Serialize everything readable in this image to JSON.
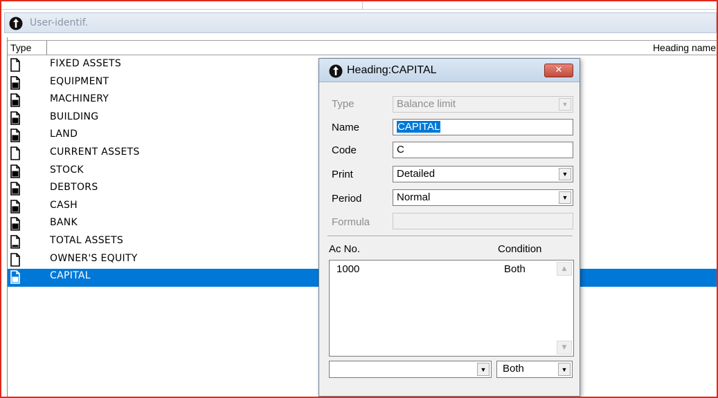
{
  "window": {
    "title": "User-identif."
  },
  "grid": {
    "columns": {
      "type": "Type",
      "heading_name": "Heading name"
    },
    "rows": [
      {
        "label": "FIXED ASSETS",
        "icon": "open-document-icon",
        "selected": false
      },
      {
        "label": "EQUIPMENT",
        "icon": "document-icon",
        "selected": false
      },
      {
        "label": "MACHINERY",
        "icon": "document-icon",
        "selected": false
      },
      {
        "label": "BUILDING",
        "icon": "document-icon",
        "selected": false
      },
      {
        "label": "LAND",
        "icon": "document-icon",
        "selected": false
      },
      {
        "label": "CURRENT ASSETS",
        "icon": "open-document-icon",
        "selected": false
      },
      {
        "label": "STOCK",
        "icon": "document-icon",
        "selected": false
      },
      {
        "label": "DEBTORS",
        "icon": "document-icon",
        "selected": false
      },
      {
        "label": "CASH",
        "icon": "document-icon",
        "selected": false
      },
      {
        "label": "BANK",
        "icon": "document-icon",
        "selected": false
      },
      {
        "label": "TOTAL ASSETS",
        "icon": "total-document-icon",
        "selected": false
      },
      {
        "label": "OWNER'S EQUITY",
        "icon": "open-document-icon",
        "selected": false
      },
      {
        "label": "CAPITAL",
        "icon": "document-icon",
        "selected": true
      }
    ]
  },
  "dialog": {
    "title": "Heading:CAPITAL",
    "close_label": "✕",
    "fields": {
      "type": {
        "label": "Type",
        "value": "Balance limit",
        "disabled": true
      },
      "name": {
        "label": "Name",
        "value": "CAPITAL"
      },
      "code": {
        "label": "Code",
        "value": "C"
      },
      "print": {
        "label": "Print",
        "value": "Detailed"
      },
      "period": {
        "label": "Period",
        "value": "Normal"
      },
      "formula": {
        "label": "Formula",
        "value": "",
        "disabled": true
      }
    },
    "accounts": {
      "headers": {
        "ac_no": "Ac No.",
        "condition": "Condition"
      },
      "items": [
        {
          "ac_no": "1000",
          "condition": "Both"
        }
      ]
    },
    "bottom": {
      "account_value": "",
      "condition_value": "Both"
    }
  },
  "colors": {
    "selection": "#0078d7",
    "frame_border": "#e02a1c",
    "close_button": "#c24a3a"
  }
}
